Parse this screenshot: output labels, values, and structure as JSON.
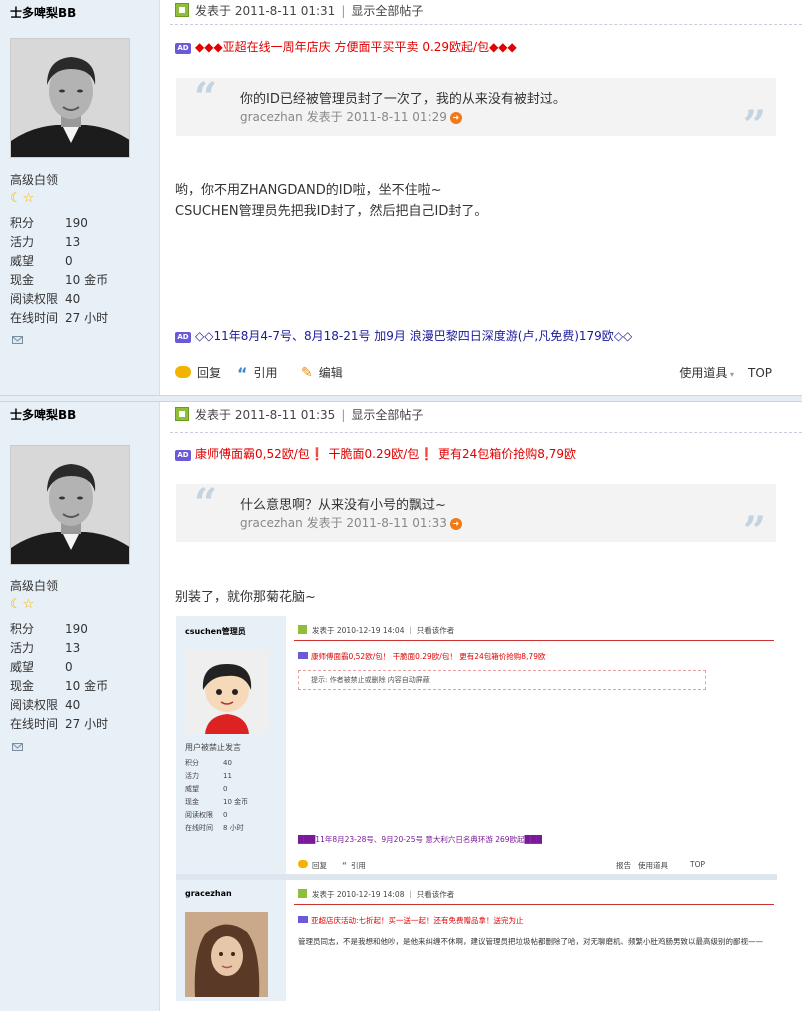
{
  "posts": [
    {
      "author": "士多啤梨BB",
      "rank": "高级白领",
      "stars": "☾☆",
      "stats": [
        {
          "k": "积分",
          "v": "190"
        },
        {
          "k": "活力",
          "v": "13"
        },
        {
          "k": "威望",
          "v": "0"
        },
        {
          "k": "现金",
          "v": "10 金币"
        },
        {
          "k": "阅读权限",
          "v": "40"
        },
        {
          "k": "在线时间",
          "v": "27 小时"
        }
      ],
      "posted": "发表于 2011-8-11 01:31",
      "show_all": "显示全部帖子",
      "ad_top": "◆◆◆亚超在线一周年店庆 方便面平买平卖 0.29欧起/包◆◆◆",
      "quote_text": "你的ID已经被管理员封了一次了，我的从来没有被封过。",
      "quote_by": "gracezhan 发表于 2011-8-11 01:29",
      "body_lines": [
        "哟，你不用ZHANGDAND的ID啦，坐不住啦~",
        "CSUCHEN管理员先把我ID封了，然后把自己ID封了。"
      ],
      "ad_bottom": "◇◇11年8月4-7号、8月18-21号 加9月 浪漫巴黎四日深度游(卢,凡免费)179欧◇◇",
      "actions": {
        "reply": "回复",
        "quote": "引用",
        "edit": "编辑",
        "tools": "使用道具",
        "top": "TOP"
      }
    },
    {
      "author": "士多啤梨BB",
      "rank": "高级白领",
      "stars": "☾☆",
      "stats": [
        {
          "k": "积分",
          "v": "190"
        },
        {
          "k": "活力",
          "v": "13"
        },
        {
          "k": "威望",
          "v": "0"
        },
        {
          "k": "现金",
          "v": "10 金币"
        },
        {
          "k": "阅读权限",
          "v": "40"
        },
        {
          "k": "在线时间",
          "v": "27 小时"
        }
      ],
      "posted": "发表于 2011-8-11 01:35",
      "show_all": "显示全部帖子",
      "ad_top": "康师傅面霸0,52欧/包❗ 干脆面0.29欧/包❗ 更有24包箱价抢购8,79欧",
      "quote_text": "什么意思啊？从来没有小号的飘过~",
      "quote_by": "gracezhan 发表于 2011-8-11 01:33",
      "body_lines": [
        "别装了，就你那菊花脑~"
      ]
    }
  ],
  "embed": {
    "u1": {
      "name": "csuchen管理员",
      "rank": "用户被禁止发言",
      "stats": [
        {
          "k": "积分",
          "v": "40"
        },
        {
          "k": "活力",
          "v": "11"
        },
        {
          "k": "威望",
          "v": "0"
        },
        {
          "k": "现金",
          "v": "10 金币"
        },
        {
          "k": "阅读权限",
          "v": "0"
        },
        {
          "k": "在线时间",
          "v": "8 小时"
        }
      ],
      "meta": "发表于 2010-12-19 14:04 ｜ 只看该作者",
      "ad": "康师傅面霸0,52欧/包！ 干脆面0.29欧/包！ 更有24包箱价抢购8,79欧",
      "notice": "提示: 作者被禁止或删除 内容自动屏蔽",
      "ad2": "███11年8月23-28号、9月20-25号 意大利六日名典环游 269欧起███",
      "reply": "回复",
      "quote": "引用",
      "report": "报告",
      "tools": "使用道具",
      "top": "TOP"
    },
    "u2": {
      "name": "gracezhan",
      "meta": "发表于 2010-12-19 14:08 ｜ 只看该作者",
      "ad": "亚超店庆活动:七折起！买一送一起！还有免费赠品拿！送完为止",
      "body": "管理员同志，不是我想和他吵，是他来纠缠不休啊，建议管理员把垃圾帖都删除了哈，对无聊磨机、频繁小肚鸡肠男致以最高级别的鄙视——"
    }
  }
}
